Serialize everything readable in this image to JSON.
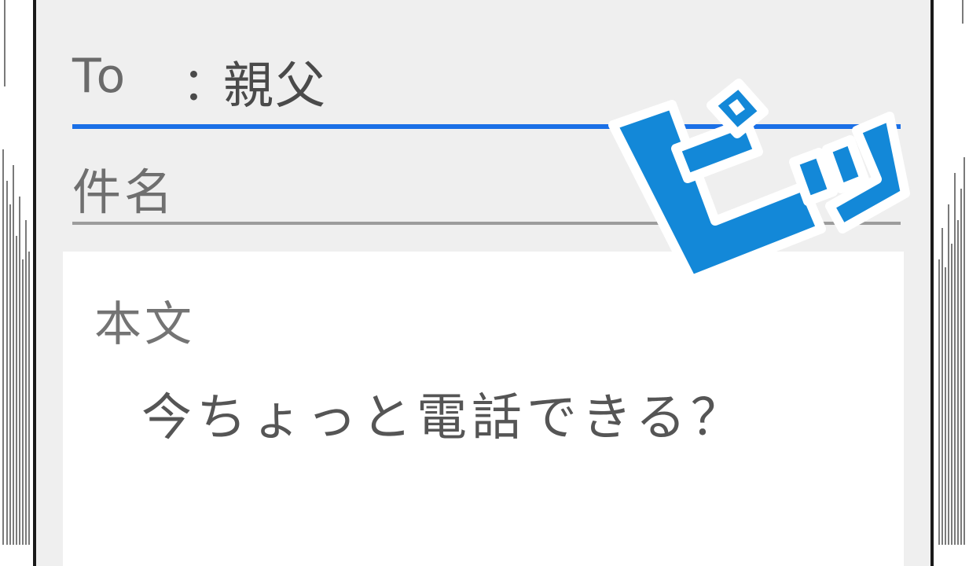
{
  "compose": {
    "to_label": "To",
    "to_colon": "：",
    "to_value": "親父",
    "subject_label": "件名",
    "body_label": "本文",
    "body_text": "今ちょっと電話できる？"
  },
  "sound_effect": "ピッ",
  "colors": {
    "screen_bg": "#efefef",
    "body_bg": "#ffffff",
    "to_underline": "#1a6fe6",
    "subject_underline": "#9c9c9c",
    "sfx_fill": "#1388d8",
    "sfx_outline": "#ffffff"
  }
}
